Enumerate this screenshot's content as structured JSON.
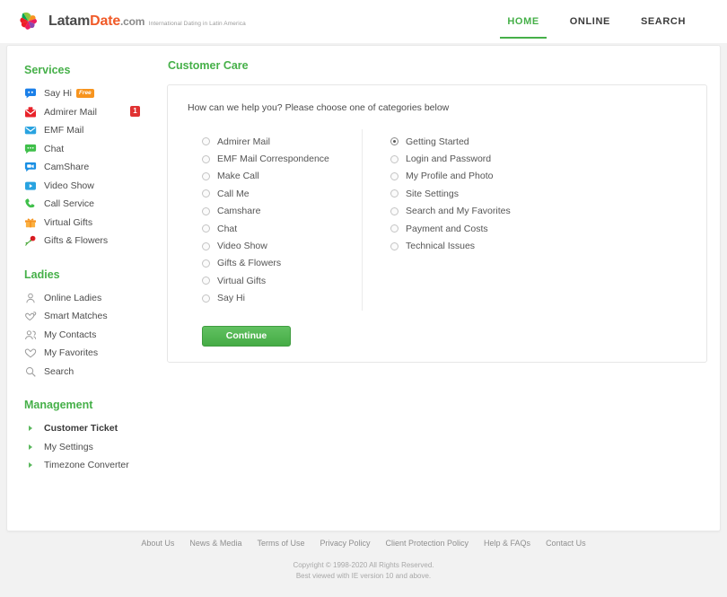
{
  "brand": {
    "name_part1": "Latam",
    "name_part2": "Date",
    "name_part3": ".com",
    "tagline": "International Dating in Latin America",
    "logo_icon": "flower-pinwheel-icon",
    "colors": {
      "orange": "#f05a28",
      "dark": "#4a4a4a"
    }
  },
  "topnav": {
    "items": [
      {
        "label": "HOME",
        "active": true
      },
      {
        "label": "ONLINE",
        "active": false
      },
      {
        "label": "SEARCH",
        "active": false
      }
    ],
    "accent": "#46b049"
  },
  "sidebar": {
    "groups": [
      {
        "title": "Services",
        "items": [
          {
            "label": "Say Hi",
            "icon": "speech-bubble-icon",
            "badge": "Free",
            "badge_type": "free"
          },
          {
            "label": "Admirer Mail",
            "icon": "admirer-mail-icon",
            "badge": "1",
            "badge_type": "count"
          },
          {
            "label": "EMF Mail",
            "icon": "envelope-icon"
          },
          {
            "label": "Chat",
            "icon": "chat-bubble-icon"
          },
          {
            "label": "CamShare",
            "icon": "video-camera-icon"
          },
          {
            "label": "Video Show",
            "icon": "play-button-icon"
          },
          {
            "label": "Call Service",
            "icon": "phone-icon"
          },
          {
            "label": "Virtual Gifts",
            "icon": "gift-box-icon"
          },
          {
            "label": "Gifts & Flowers",
            "icon": "rose-flower-icon"
          }
        ]
      },
      {
        "title": "Ladies",
        "items": [
          {
            "label": "Online Ladies",
            "icon": "person-outline-icon"
          },
          {
            "label": "Smart Matches",
            "icon": "double-heart-icon"
          },
          {
            "label": "My Contacts",
            "icon": "people-outline-icon"
          },
          {
            "label": "My Favorites",
            "icon": "heart-outline-icon"
          },
          {
            "label": "Search",
            "icon": "magnifier-icon"
          }
        ]
      },
      {
        "title": "Management",
        "items": [
          {
            "label": "Customer Ticket",
            "icon": "arrow-right-icon",
            "active": true
          },
          {
            "label": "My Settings",
            "icon": "arrow-right-icon"
          },
          {
            "label": "Timezone Converter",
            "icon": "arrow-right-icon"
          }
        ]
      }
    ]
  },
  "content": {
    "title": "Customer Care",
    "question": "How can we help you? Please choose one of categories below",
    "categories_left": [
      {
        "label": "Admirer Mail",
        "checked": false
      },
      {
        "label": "EMF Mail Correspondence",
        "checked": false
      },
      {
        "label": "Make Call",
        "checked": false
      },
      {
        "label": "Call Me",
        "checked": false
      },
      {
        "label": "Camshare",
        "checked": false
      },
      {
        "label": "Chat",
        "checked": false
      },
      {
        "label": "Video Show",
        "checked": false
      },
      {
        "label": "Gifts & Flowers",
        "checked": false
      },
      {
        "label": "Virtual Gifts",
        "checked": false
      },
      {
        "label": "Say Hi",
        "checked": false
      }
    ],
    "categories_right": [
      {
        "label": "Getting Started",
        "checked": true
      },
      {
        "label": "Login and Password",
        "checked": false
      },
      {
        "label": "My Profile and Photo",
        "checked": false
      },
      {
        "label": "Site Settings",
        "checked": false
      },
      {
        "label": "Search and My Favorites",
        "checked": false
      },
      {
        "label": "Payment and Costs",
        "checked": false
      },
      {
        "label": "Technical Issues",
        "checked": false
      }
    ],
    "continue_label": "Continue",
    "button_color": "#4cae4c"
  },
  "footer": {
    "links": [
      "About Us",
      "News & Media",
      "Terms of Use",
      "Privacy Policy",
      "Client Protection Policy",
      "Help & FAQs",
      "Contact Us"
    ],
    "copyright_line1": "Copyright © 1998-2020 All Rights Reserved.",
    "copyright_line2": "Best viewed with IE version 10 and above."
  }
}
